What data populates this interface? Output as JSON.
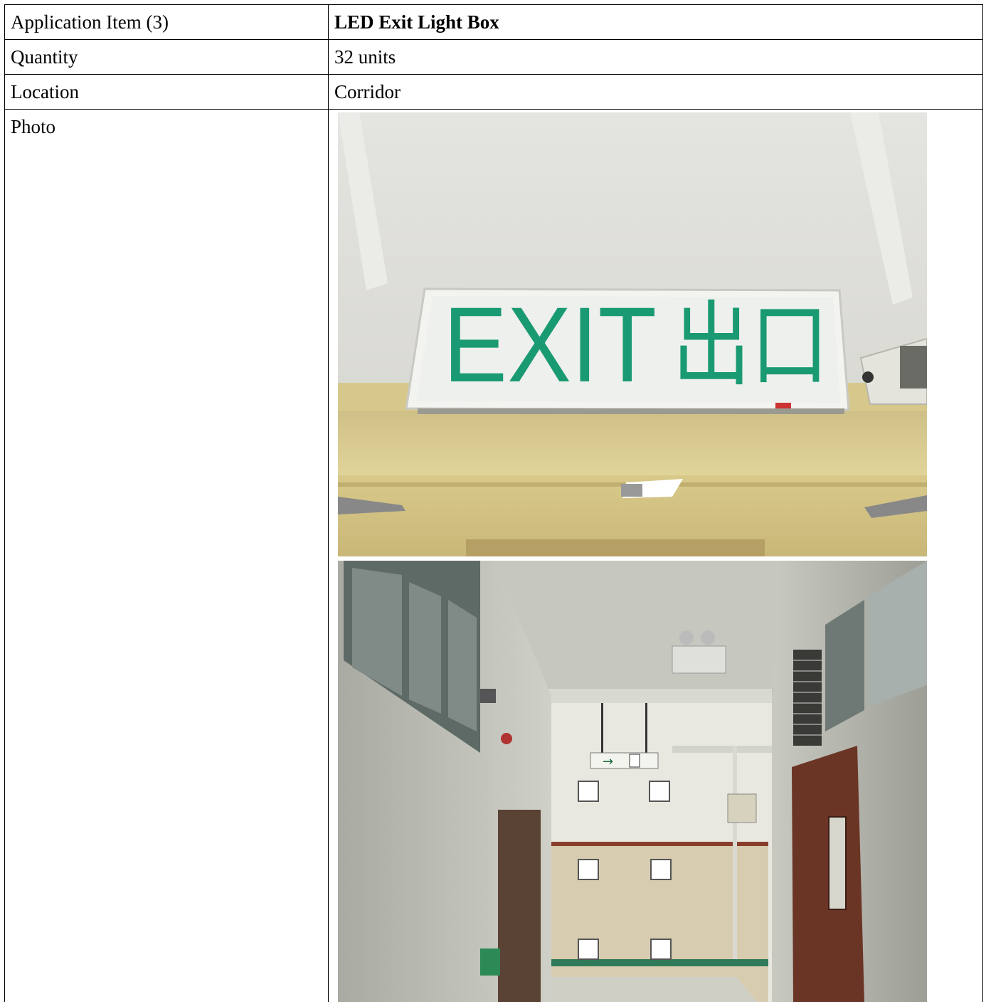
{
  "rows": [
    {
      "label": "Application Item (3)",
      "value": "LED Exit Light Box"
    },
    {
      "label": "Quantity",
      "value": "32 units"
    },
    {
      "label": "Location",
      "value": "Corridor"
    }
  ],
  "photo_label": "Photo",
  "photo1": {
    "exit_text": "EXIT",
    "chinese_text": "出口"
  },
  "colors": {
    "sign_green": "#1a9a72",
    "ceiling": "#e2e2de",
    "beam": "#d9cc8f",
    "wall": "#b7b8b0"
  }
}
